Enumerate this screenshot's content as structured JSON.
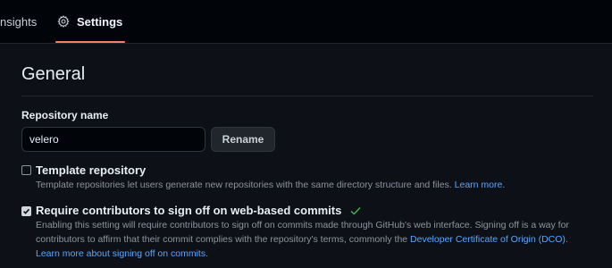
{
  "nav": {
    "tabs": [
      {
        "label": "nsights"
      },
      {
        "label": "Settings",
        "icon": "gear-icon",
        "active": true
      }
    ]
  },
  "general": {
    "title": "General",
    "repo_name_label": "Repository name",
    "repo_name_value": "velero",
    "rename_label": "Rename"
  },
  "template_option": {
    "checked": false,
    "title": "Template repository",
    "description": "Template repositories let users generate new repositories with the same directory structure and files.",
    "learn_more": "Learn more."
  },
  "signoff_option": {
    "checked": true,
    "title": "Require contributors to sign off on web-based commits",
    "description_line1": "Enabling this setting will require contributors to sign off on commits made through GitHub's web interface. Signing off is a way for",
    "description_line2": "contributors to affirm that their commit complies with the repository's terms, commonly the",
    "dco_link": "Developer Certificate of Origin (DCO)",
    "dco_suffix": ".",
    "learn_more": "Learn more about signing off on commits."
  },
  "colors": {
    "accent_link": "#58a6ff",
    "tab_underline": "#f78166",
    "success": "#3fb950"
  }
}
